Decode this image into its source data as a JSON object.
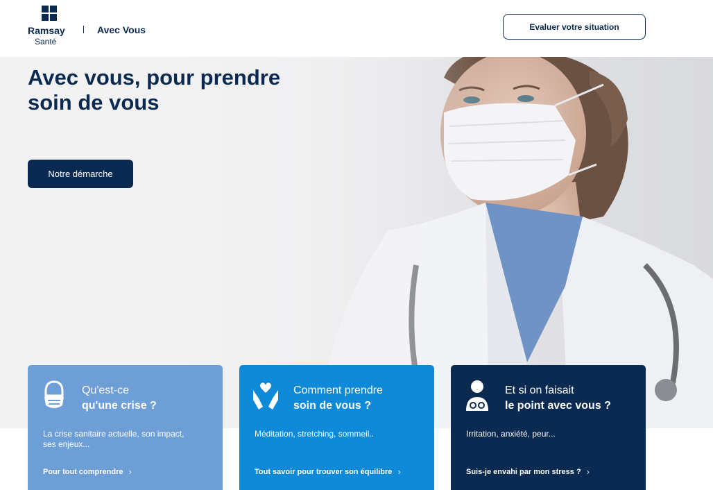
{
  "header": {
    "brand": "Ramsay",
    "brand_sub": "Santé",
    "title": "Avec Vous",
    "cta_label": "Evaluer votre situation"
  },
  "hero": {
    "heading_line1": "Avec vous, pour prendre",
    "heading_line2": "soin de vous",
    "button_label": "Notre démarche"
  },
  "cards": [
    {
      "title_line1": "Qu'est-ce",
      "title_line2": "qu'une crise ?",
      "description": "La crise sanitaire actuelle, son impact, ses enjeux...",
      "link_label": "Pour tout comprendre",
      "icon": "mask-face-icon",
      "color": "#6e9ed6"
    },
    {
      "title_line1": "Comment prendre",
      "title_line2": "soin de vous ?",
      "description": "Méditation, stretching, sommeil..",
      "link_label": "Tout savoir pour trouver son équilibre",
      "icon": "hands-heart-icon",
      "color": "#0e8ad8"
    },
    {
      "title_line1": "Et si on faisait",
      "title_line2": "le point avec vous ?",
      "description": "Irritation, anxiété, peur...",
      "link_label": "Suis-je envahi par mon stress ?",
      "icon": "doctor-stethoscope-icon",
      "color": "#0b2a52"
    }
  ],
  "colors": {
    "navy": "#0b2a52",
    "light_blue": "#6e9ed6",
    "blue": "#0e8ad8"
  }
}
